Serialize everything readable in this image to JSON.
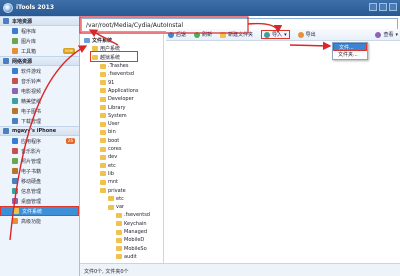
{
  "app": {
    "title": "iTools 2013"
  },
  "sidebar": {
    "local_header": "本地资源",
    "local_items": [
      {
        "label": "程序库",
        "color": "#3a7bd5"
      },
      {
        "label": "图片库",
        "color": "#6aa84f"
      },
      {
        "label": "工具箱",
        "color": "#e69138",
        "badge": "new"
      }
    ],
    "net_header": "网络资源",
    "net_items": [
      {
        "label": "软件游戏",
        "color": "#3a7bd5"
      },
      {
        "label": "音乐铃声",
        "color": "#c94f4f"
      },
      {
        "label": "电影视频",
        "color": "#8e63b5"
      },
      {
        "label": "精美壁纸",
        "color": "#3aa0a0"
      },
      {
        "label": "电子图书",
        "color": "#b5762c"
      },
      {
        "label": "下载管理",
        "color": "#4c7fbf"
      }
    ],
    "device_header": "mgayy's iPhone",
    "device_items": [
      {
        "label": "应用程序",
        "color": "#3a7bd5",
        "badge": "26"
      },
      {
        "label": "音乐影片",
        "color": "#c94f4f"
      },
      {
        "label": "照片管理",
        "color": "#6aa84f"
      },
      {
        "label": "电子书籍",
        "color": "#b5762c"
      },
      {
        "label": "移动硬盘",
        "color": "#4c7fbf"
      },
      {
        "label": "信息管理",
        "color": "#3aa0a0"
      },
      {
        "label": "桌面管理",
        "color": "#8e63b5"
      },
      {
        "label": "文件系统",
        "color": "#f0c24b",
        "active": true
      },
      {
        "label": "高级功能",
        "color": "#e69138"
      }
    ]
  },
  "path": "/var/root/Media/Cydia/AutoInstal",
  "tree": {
    "root": "文件系统",
    "user_fs": "用户系统",
    "raw_fs": "越狱系统",
    "items": [
      ".Trashes",
      ".fseventsd",
      "91",
      "Applications",
      "Developer",
      "Library",
      "System",
      "User",
      "bin",
      "boot",
      "cores",
      "dev",
      "etc",
      "lib",
      "mnt",
      "private"
    ],
    "private_children": [
      "etc",
      "var"
    ],
    "var_children": [
      ".fseventsd",
      "Keychain",
      "Managed",
      "MobileD",
      "MobileSo",
      "audit"
    ]
  },
  "toolbar": {
    "back": "后退",
    "refresh": "刷新",
    "new_folder": "新建文件夹",
    "import": "导入",
    "export": "导出",
    "view": "查看"
  },
  "popup": {
    "item1": "文件...",
    "item2": "文件夹..."
  },
  "status": {
    "text": "文件0个, 文件夹0个"
  }
}
